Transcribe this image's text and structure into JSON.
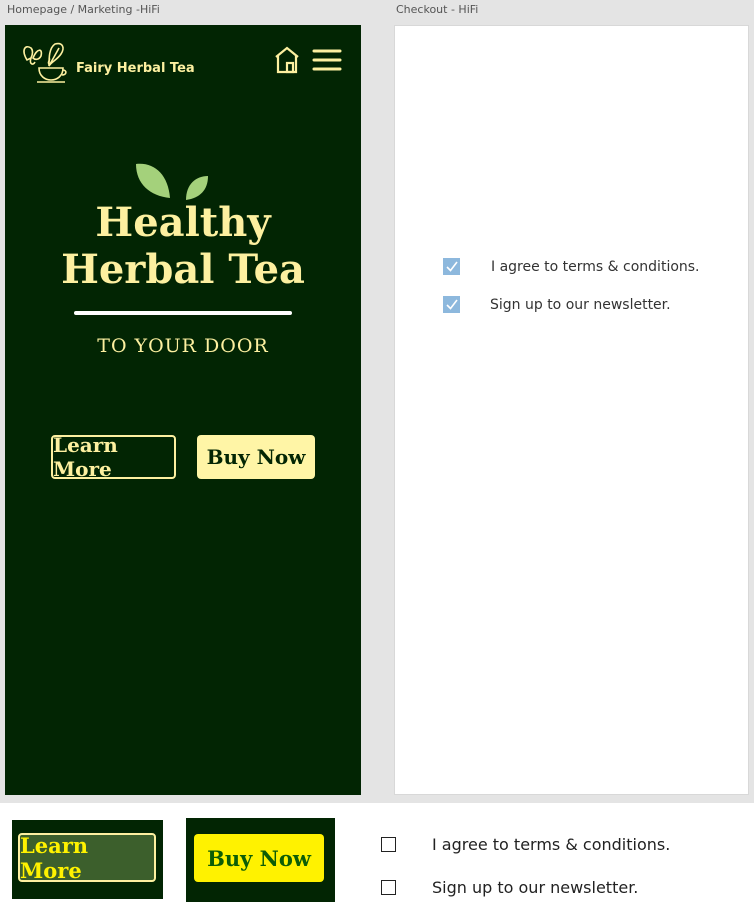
{
  "frames": {
    "homepage_label": "Homepage / Marketing -HiFi",
    "checkout_label": "Checkout - HiFi"
  },
  "header": {
    "brand_name": "Fairy Herbal Tea",
    "logo_icon": "fairy-teacup-logo",
    "home_icon": "home-icon",
    "menu_icon": "hamburger-menu-icon"
  },
  "hero": {
    "title_line1": "Healthy",
    "title_line2": "Herbal Tea",
    "subtitle": "TO YOUR DOOR",
    "decor_icon": "leaves-icon"
  },
  "buttons": {
    "learn_more": "Learn More",
    "buy_now": "Buy Now"
  },
  "checkout": {
    "options": [
      {
        "label": "I agree to terms & conditions.",
        "checked": true
      },
      {
        "label": "Sign up to our newsletter.",
        "checked": true
      }
    ]
  },
  "components": {
    "learn_more": "Learn More",
    "buy_now": "Buy Now",
    "options": [
      {
        "label": "I agree to terms & conditions.",
        "checked": false
      },
      {
        "label": "Sign up to our newsletter.",
        "checked": false
      }
    ]
  },
  "colors": {
    "canvas": "#e4e4e4",
    "brand_dark_green": "#022503",
    "cream": "#fdf0a0",
    "button_cream": "#fff5a6",
    "yellow": "#fff200",
    "hover_green": "#3c5f2c",
    "checkbox_blue": "#8db8dd"
  }
}
